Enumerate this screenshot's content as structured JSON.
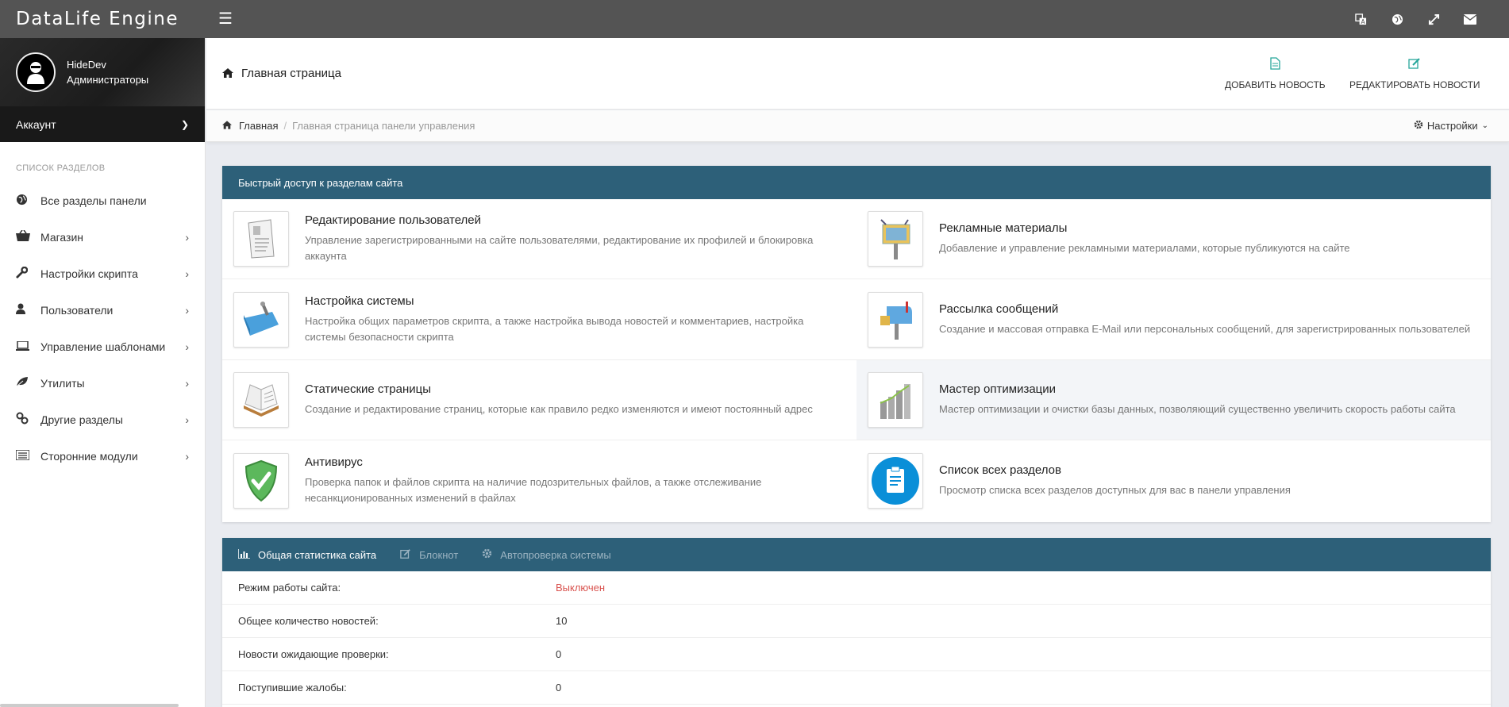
{
  "app": {
    "brand": "DataLife Engine"
  },
  "topbar": {
    "menu_icon": "hamburger-icon",
    "icons": [
      "translate-icon",
      "globe-icon",
      "expand-icon",
      "envelope-icon"
    ]
  },
  "user": {
    "name": "HideDev",
    "group": "Администраторы",
    "account_label": "Аккаунт"
  },
  "sidebar": {
    "section_title": "Список разделов",
    "items": [
      {
        "label": "Все разделы панели",
        "icon": "globe-icon"
      },
      {
        "label": "Магазин",
        "icon": "basket-icon"
      },
      {
        "label": "Настройки скрипта",
        "icon": "wrench-icon"
      },
      {
        "label": "Пользователи",
        "icon": "user-icon"
      },
      {
        "label": "Управление шаблонами",
        "icon": "laptop-icon"
      },
      {
        "label": "Утилиты",
        "icon": "leaf-icon"
      },
      {
        "label": "Другие разделы",
        "icon": "link-icon"
      },
      {
        "label": "Сторонние модули",
        "icon": "list-icon"
      }
    ]
  },
  "header": {
    "title": "Главная страница",
    "add_news": "ДОБАВИТЬ НОВОСТЬ",
    "edit_news": "РЕДАКТИРОВАТЬ НОВОСТИ"
  },
  "breadcrumb": {
    "home": "Главная",
    "current": "Главная страница панели управления",
    "settings": "Настройки"
  },
  "quick_access": {
    "title": "Быстрый доступ к разделам сайта",
    "items": [
      {
        "title": "Редактирование пользователей",
        "desc": "Управление зарегистрированными на сайте пользователями, редактирование их профилей и блокировка аккаунта",
        "icon": "user-form-icon"
      },
      {
        "title": "Рекламные материалы",
        "desc": "Добавление и управление рекламными материалами, которые публикуются на сайте",
        "icon": "billboard-icon"
      },
      {
        "title": "Настройка системы",
        "desc": "Настройка общих параметров скрипта, а также настройка вывода новостей и комментариев, настройка системы безопасности скрипта",
        "icon": "toolbox-icon"
      },
      {
        "title": "Рассылка сообщений",
        "desc": "Создание и массовая отправка E-Mail или персональных сообщений, для зарегистрированных пользователей",
        "icon": "mailbox-icon"
      },
      {
        "title": "Статические страницы",
        "desc": "Создание и редактирование страниц, которые как правило редко изменяются и имеют постоянный адрес",
        "icon": "open-book-icon"
      },
      {
        "title": "Мастер оптимизации",
        "desc": "Мастер оптимизации и очистки базы данных, позволяющий существенно увеличить скорость работы сайта",
        "icon": "bar-graph-icon"
      },
      {
        "title": "Антивирус",
        "desc": "Проверка папок и файлов скрипта на наличие подозрительных файлов, а также отслеживание несанкционированных изменений в файлах",
        "icon": "shield-check-icon"
      },
      {
        "title": "Список всех разделов",
        "desc": "Просмотр списка всех разделов доступных для вас в панели управления",
        "icon": "clipboard-icon"
      }
    ]
  },
  "stats": {
    "tabs": [
      {
        "label": "Общая статистика сайта",
        "icon": "bar-chart-icon"
      },
      {
        "label": "Блокнот",
        "icon": "edit-icon"
      },
      {
        "label": "Автопроверка системы",
        "icon": "gear-icon"
      }
    ],
    "rows": [
      {
        "label": "Режим работы сайта:",
        "value": "Выключен"
      },
      {
        "label": "Общее количество новостей:",
        "value": "10"
      },
      {
        "label": "Новости ожидающие проверки:",
        "value": "0"
      },
      {
        "label": "Поступившие жалобы:",
        "value": "0"
      }
    ],
    "off_color": "#d9534f"
  },
  "colors": {
    "topbar": "#545454",
    "panel_head": "#2d6079",
    "accent": "#26a69a"
  }
}
